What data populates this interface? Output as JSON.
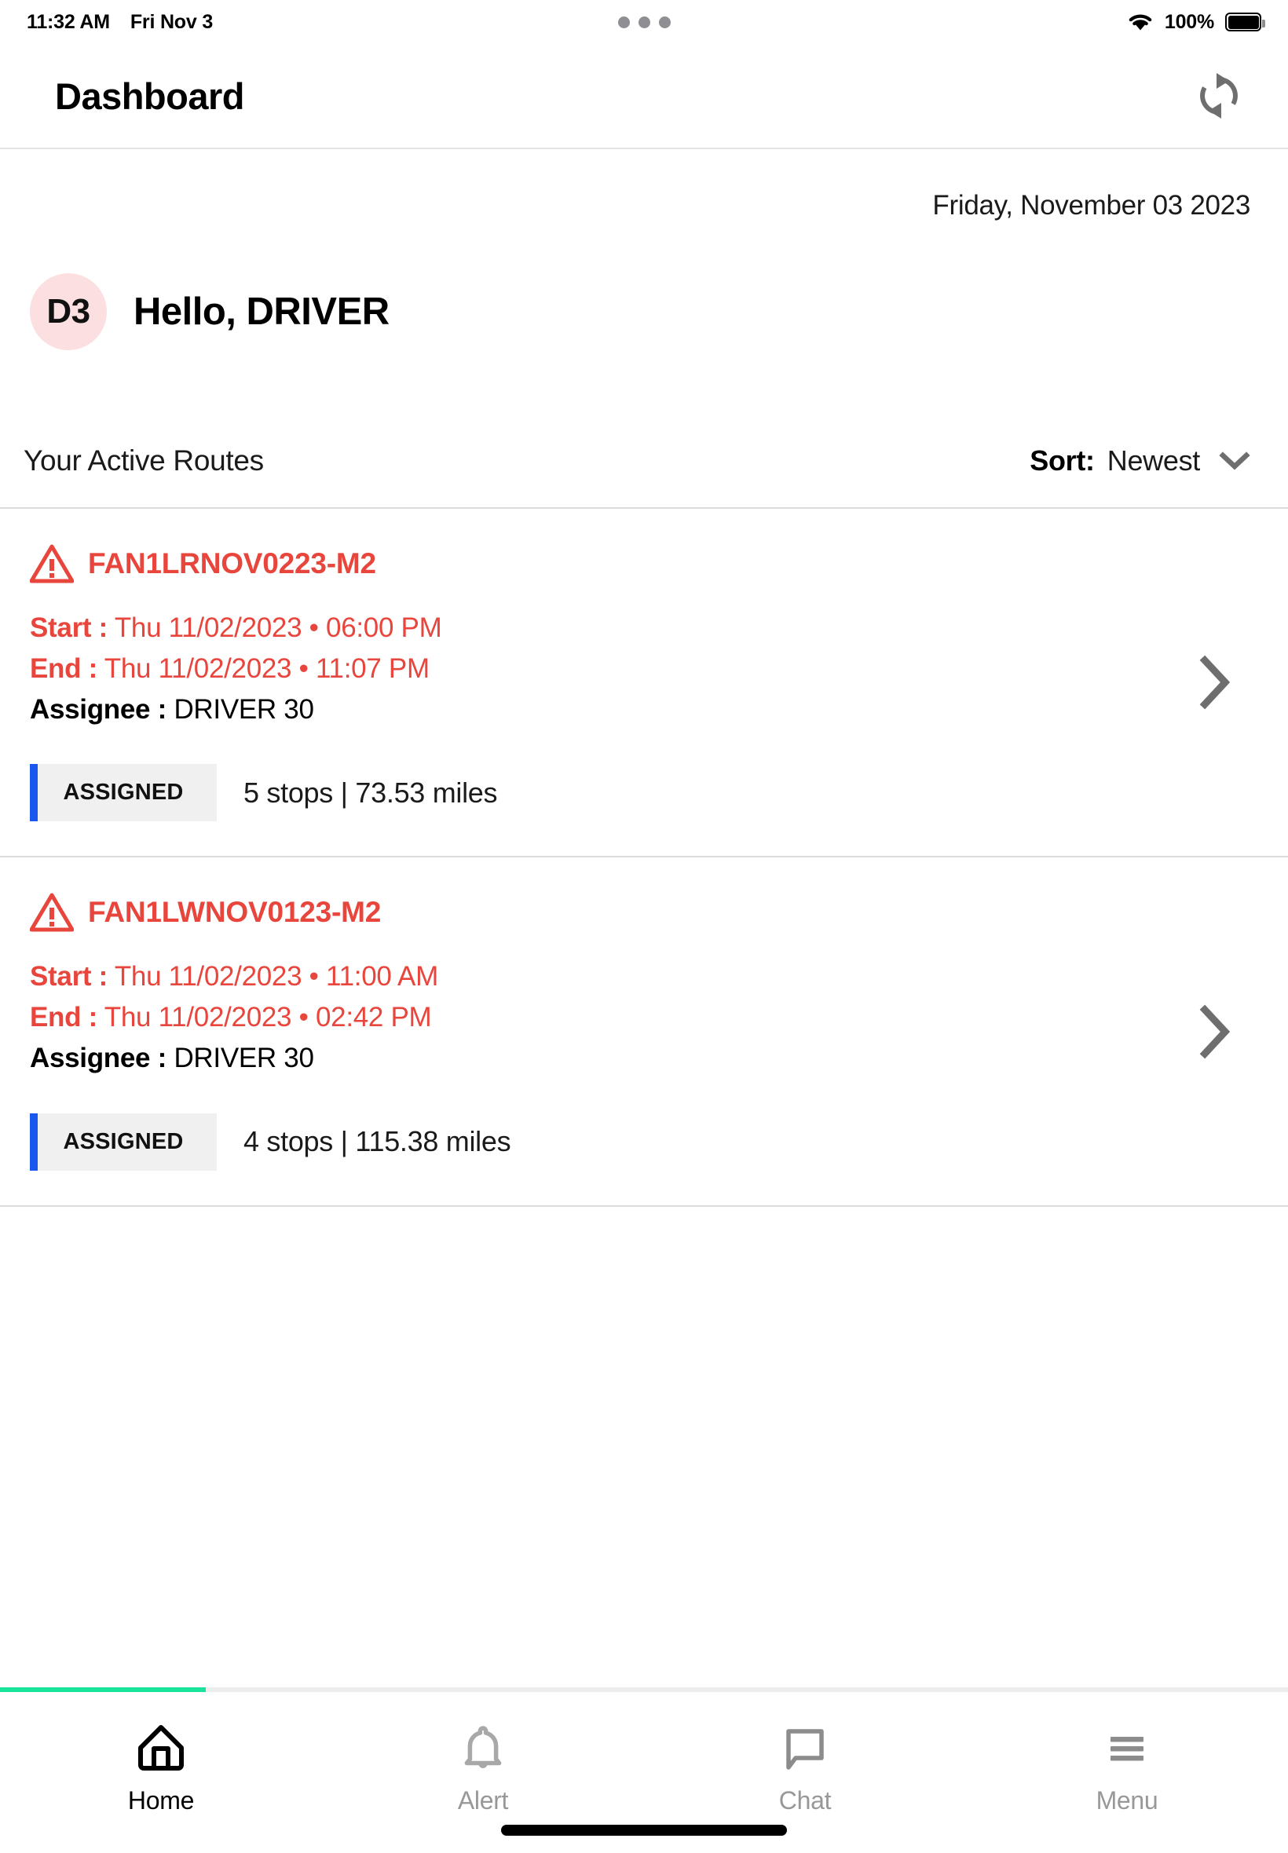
{
  "status_bar": {
    "time": "11:32 AM",
    "date": "Fri Nov 3",
    "battery_percent": "100%",
    "wifi_icon": "wifi-icon",
    "battery_icon": "battery-full-icon",
    "multitask_icon": "three-dots-icon"
  },
  "header": {
    "title": "Dashboard",
    "refresh_icon": "refresh-icon"
  },
  "main": {
    "date_label": "Friday, November 03 2023",
    "avatar_initials": "D3",
    "greeting": "Hello, DRIVER",
    "section_title": "Your Active Routes",
    "sort": {
      "label": "Sort:",
      "value": "Newest",
      "chevron_icon": "chevron-down-icon"
    }
  },
  "routes": [
    {
      "name": "FAN1LRNOV0223-M2",
      "warning_icon": "warning-triangle-icon",
      "start_label": "Start :",
      "start_value": "Thu 11/02/2023 • 06:00 PM",
      "end_label": "End :",
      "end_value": "Thu 11/02/2023 • 11:07 PM",
      "assignee_label": "Assignee :",
      "assignee_value": "DRIVER 30",
      "status": "ASSIGNED",
      "summary": "5 stops | 73.53 miles",
      "chevron_icon": "chevron-right-icon"
    },
    {
      "name": "FAN1LWNOV0123-M2",
      "warning_icon": "warning-triangle-icon",
      "start_label": "Start :",
      "start_value": "Thu 11/02/2023 • 11:00 AM",
      "end_label": "End :",
      "end_value": "Thu 11/02/2023 • 02:42 PM",
      "assignee_label": "Assignee :",
      "assignee_value": "DRIVER 30",
      "status": "ASSIGNED",
      "summary": "4 stops | 115.38 miles",
      "chevron_icon": "chevron-right-icon"
    }
  ],
  "bottom_nav": {
    "items": [
      {
        "label": "Home",
        "icon": "home-icon",
        "active": true
      },
      {
        "label": "Alert",
        "icon": "bell-icon",
        "active": false
      },
      {
        "label": "Chat",
        "icon": "chat-bubble-icon",
        "active": false
      },
      {
        "label": "Menu",
        "icon": "hamburger-menu-icon",
        "active": false
      }
    ]
  },
  "colors": {
    "alert_red": "#e8453c",
    "badge_blue": "#1a56f0",
    "progress_green": "#17e39a",
    "avatar_pink": "#fbdfe1",
    "muted_gray": "#989898"
  },
  "progress": {
    "percent": 16
  }
}
